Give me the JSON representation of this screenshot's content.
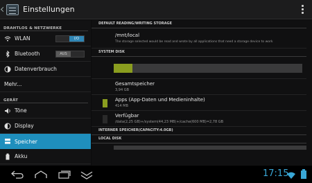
{
  "actionbar": {
    "title": "Einstellungen"
  },
  "left": {
    "sections": [
      {
        "header": "DRAHTLOS & NETZWERKE"
      },
      {
        "header": "GERÄT"
      }
    ],
    "items": [
      {
        "label": "WLAN",
        "icon": "wifi-icon",
        "toggle": "I/O"
      },
      {
        "label": "Bluetooth",
        "icon": "bluetooth-icon",
        "toggle": "AUS"
      },
      {
        "label": "Datenverbrauch",
        "icon": "data-usage-icon"
      },
      {
        "label": "Mehr..."
      },
      {
        "label": "Töne",
        "icon": "volume-icon"
      },
      {
        "label": "Display",
        "icon": "display-brightness-icon"
      },
      {
        "label": "Speicher",
        "icon": "storage-icon",
        "selected": true
      },
      {
        "label": "Akku",
        "icon": "battery-icon"
      }
    ]
  },
  "right": {
    "default_header": "DEFAULT READING/WRITING STORAGE",
    "path_title": "/mnt/local",
    "path_desc": "The storage selected would be read and wrote by all applications that need a storage device to work",
    "system_disk_header": "SYSTEM DISK",
    "usage_fraction": 0.1,
    "usage_color": "#8a9d1f",
    "total_label": "Gesamtspeicher",
    "total_value": "3,94 GB",
    "apps_label": "Apps (App-Daten und Medieninhalte)",
    "apps_value": "414 MB",
    "apps_color": "#8a9d1f",
    "avail_label": "Verfügbar",
    "avail_value": "/data(2,25 GB)+/system(44,23 MB)+/cache(600 MB)=2,78 GB",
    "avail_color": "#2a2a2a",
    "internal_header": "INTERNER SPEICHER(CAPACITY:4.0GB)",
    "local_disk_header": "LOCAL DISK"
  },
  "navbar": {
    "time": "17:15"
  },
  "colors": {
    "accent": "#1f8fbd",
    "clock": "#39a7d6"
  }
}
